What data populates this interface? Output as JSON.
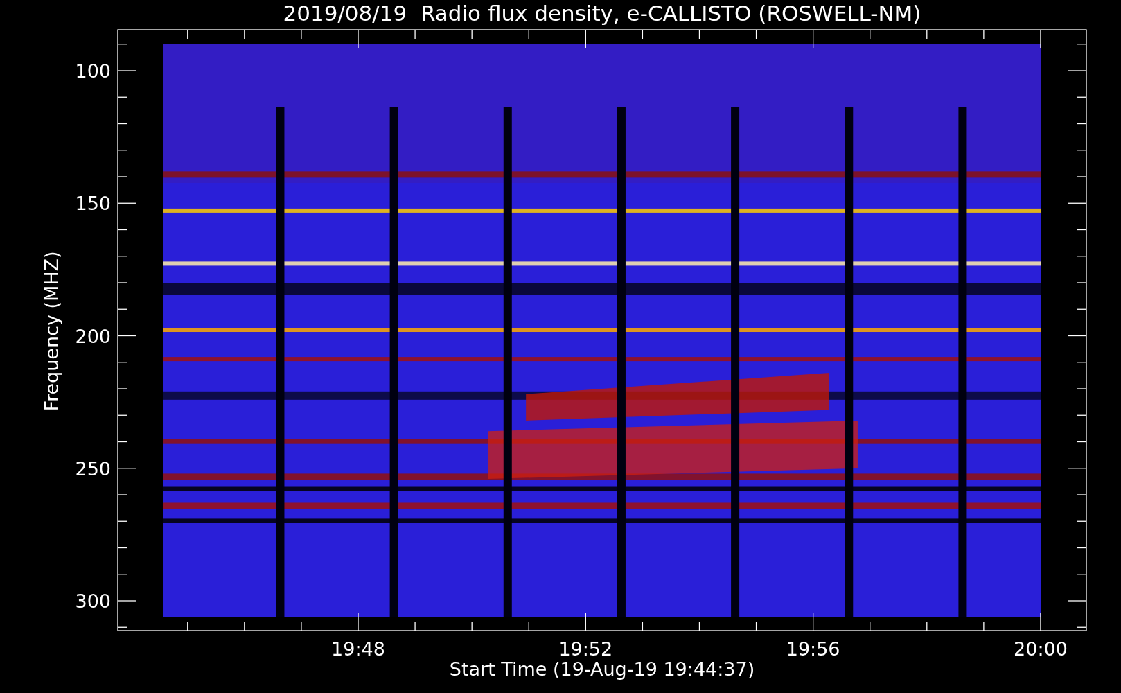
{
  "title": "2019/08/19  Radio flux density, e-CALLISTO (ROSWELL-NM)",
  "y_axis": {
    "label": "Frequency (MHZ)",
    "ticks": [
      "100",
      "150",
      "200",
      "250",
      "300"
    ]
  },
  "x_axis": {
    "label": "Start Time (19-Aug-19 19:44:37)",
    "ticks": [
      "19:48",
      "19:52",
      "19:56",
      "20:00"
    ]
  }
}
